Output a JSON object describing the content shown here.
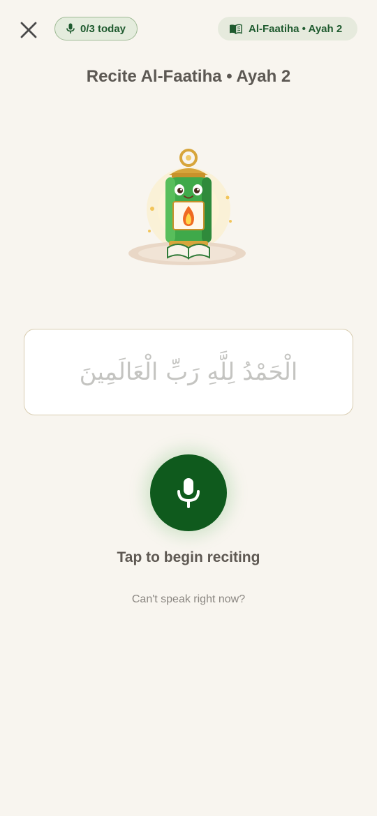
{
  "header": {
    "today_counter": "0/3 today",
    "ayah_pill": "Al-Faatiha • Ayah 2"
  },
  "page": {
    "title": "Recite Al-Faatiha • Ayah 2"
  },
  "verse": {
    "arabic": "الْحَمْدُ لِلَّهِ رَبِّ الْعَالَمِينَ"
  },
  "actions": {
    "cta": "Tap to begin reciting",
    "alt_link": "Can't speak right now?"
  },
  "colors": {
    "background": "#f8f5ef",
    "primary_green": "#0f5a1d",
    "pill_text": "#1e5a2e"
  },
  "icons": {
    "close": "close-icon",
    "mic_small": "mic-icon",
    "book": "book-icon",
    "mic_large": "mic-icon"
  }
}
